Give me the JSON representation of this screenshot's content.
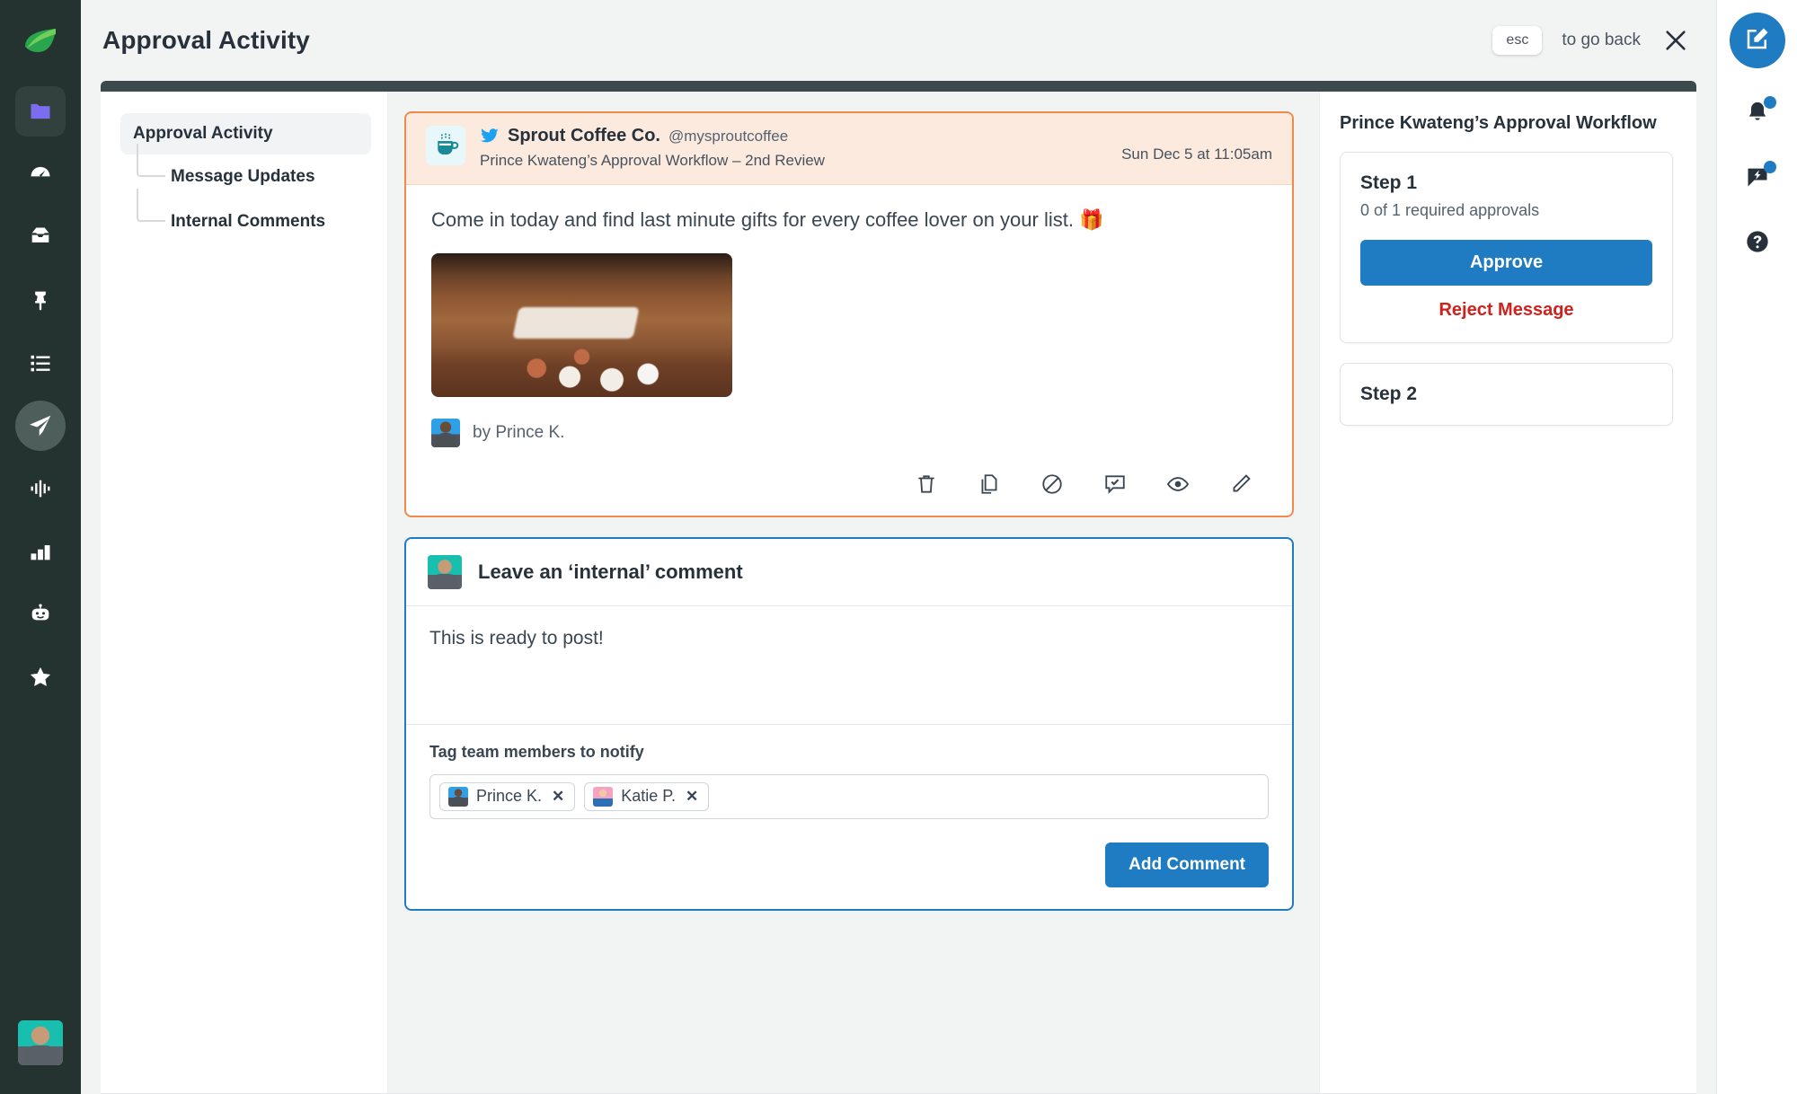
{
  "app": {
    "brand_green": "#3cb44a",
    "accent_blue": "#1f7cc2",
    "danger_red": "#d0211c",
    "highlight_orange": "#f08a4b"
  },
  "left_rail": {
    "logo": "sprout-leaf-logo",
    "items": [
      {
        "icon": "folder-icon",
        "name": "folder",
        "active": "true"
      },
      {
        "icon": "dashboard-speedometer-icon",
        "name": "dashboard",
        "active": "false"
      },
      {
        "icon": "inbox-icon",
        "name": "inbox",
        "active": "false"
      },
      {
        "icon": "pushpin-icon",
        "name": "pinned",
        "active": "false"
      },
      {
        "icon": "list-icon",
        "name": "tasks",
        "active": "false"
      },
      {
        "icon": "paper-plane-icon",
        "name": "publishing",
        "active": "true"
      },
      {
        "icon": "sound-wave-icon",
        "name": "listening",
        "active": "false"
      },
      {
        "icon": "bar-chart-icon",
        "name": "reports",
        "active": "false"
      },
      {
        "icon": "robot-icon",
        "name": "bots",
        "active": "false"
      },
      {
        "icon": "star-icon",
        "name": "reviews",
        "active": "false"
      }
    ],
    "user_avatar": "user-avatar"
  },
  "header": {
    "title": "Approval Activity",
    "esc_key_label": "esc",
    "esc_hint": "to go back",
    "close_icon": "close-icon"
  },
  "tree": {
    "root": "Approval Activity",
    "children": [
      "Message Updates",
      "Internal Comments"
    ]
  },
  "post": {
    "network_icon": "twitter-icon",
    "profile_avatar": "coffee-cup-avatar",
    "profile_name": "Sprout Coffee Co.",
    "handle": "@mysproutcoffee",
    "workflow_line": "Prince Kwateng’s Approval Workflow – 2nd Review",
    "timestamp": "Sun Dec 5 at 11:05am",
    "body_text": "Come in today and find last minute gifts for every coffee lover on your list. 🎁",
    "attachment": "coffee-mugs-photo",
    "byline_avatar": "prince-avatar",
    "byline": "by Prince K.",
    "actions": [
      {
        "icon": "trash-icon",
        "name": "delete-message"
      },
      {
        "icon": "copy-icon",
        "name": "duplicate-message"
      },
      {
        "icon": "block-icon",
        "name": "block-message"
      },
      {
        "icon": "comment-check-icon",
        "name": "approve-comment"
      },
      {
        "icon": "eye-icon",
        "name": "preview-message"
      },
      {
        "icon": "pencil-icon",
        "name": "edit-message"
      }
    ]
  },
  "composer": {
    "avatar": "current-user-avatar",
    "title": "Leave an ‘internal’ comment",
    "comment_value": "This is ready to post!",
    "comment_placeholder": "Leave an ‘internal’ comment",
    "tag_label": "Tag team members to notify",
    "tags": [
      {
        "name": "Prince K.",
        "avatar": "prince-avatar",
        "remove_icon": "close-icon"
      },
      {
        "name": "Katie P.",
        "avatar": "katie-avatar",
        "remove_icon": "close-icon"
      }
    ],
    "submit_label": "Add Comment"
  },
  "workflow": {
    "title": "Prince Kwateng’s Approval Workflow",
    "steps": [
      {
        "title": "Step 1",
        "subtitle": "0 of 1 required approvals",
        "approve_label": "Approve",
        "reject_label": "Reject Message"
      },
      {
        "title": "Step 2"
      }
    ]
  },
  "right_rail": {
    "compose_icon": "compose-pencil-square-icon",
    "items": [
      {
        "icon": "bell-icon",
        "name": "notifications",
        "badge": "true"
      },
      {
        "icon": "chat-bolt-icon",
        "name": "messages",
        "badge": "true"
      },
      {
        "icon": "help-question-icon",
        "name": "help",
        "badge": "false"
      }
    ]
  }
}
